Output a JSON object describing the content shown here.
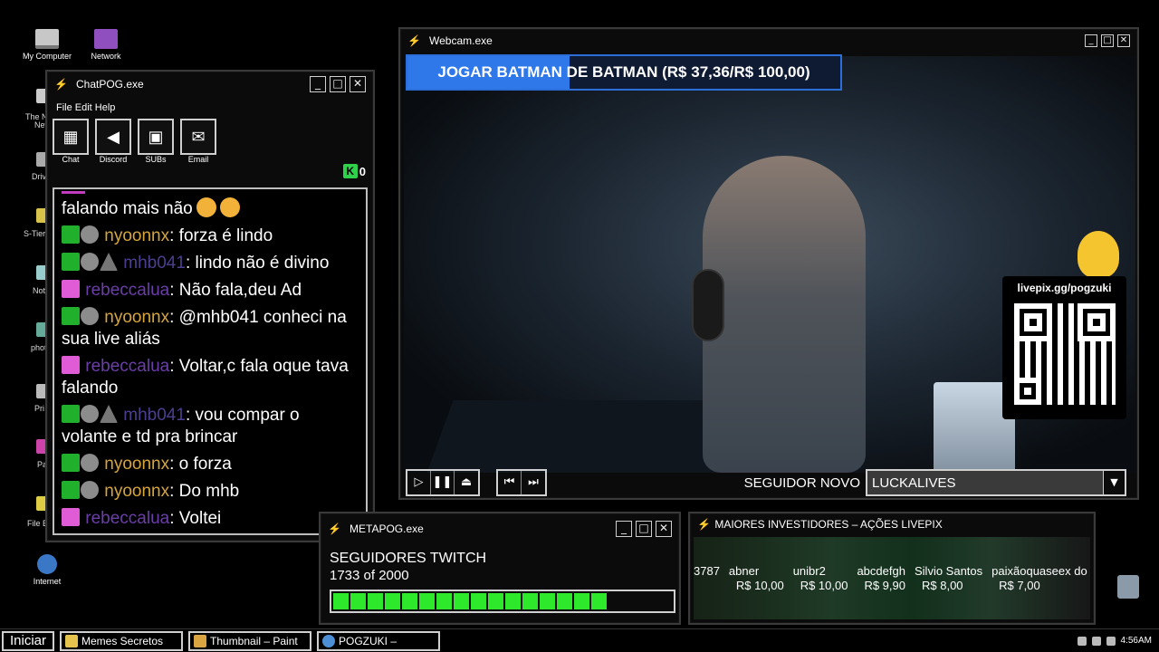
{
  "desktop": {
    "icons": [
      {
        "label": "My Computer"
      },
      {
        "label": "Network"
      },
      {
        "label": "Internet"
      }
    ],
    "fragments": [
      "The N",
      "Net",
      "Driv",
      "S-Tier",
      "Not",
      "photo",
      "Pri",
      "Pa",
      "File E"
    ]
  },
  "chat_window": {
    "title": "ChatPOG.exe",
    "menu": "File Edit Help",
    "tools": [
      {
        "label": "Chat"
      },
      {
        "label": "Discord"
      },
      {
        "label": "SUBs"
      },
      {
        "label": "Email"
      }
    ],
    "k_count": "0",
    "messages": [
      {
        "user": "",
        "text": "falando mais não",
        "user_color": "#ffffff"
      },
      {
        "user": "nyoonnx",
        "text": ": forza é lindo",
        "user_color": "#d7a53b"
      },
      {
        "user": "mhb041",
        "text": ": lindo não é divino",
        "user_color": "#4b3f8f"
      },
      {
        "user": "rebeccalua",
        "text": ": Não fala,deu Ad",
        "user_color": "#6b3ea8"
      },
      {
        "user": "nyoonnx",
        "text": ": @mhb041 conheci na sua live aliás",
        "user_color": "#d7a53b"
      },
      {
        "user": "rebeccalua",
        "text": ": Voltar,c fala oque tava falando",
        "user_color": "#6b3ea8"
      },
      {
        "user": "mhb041",
        "text": ": vou compar o volante e td pra brincar",
        "user_color": "#4b3f8f"
      },
      {
        "user": "nyoonnx",
        "text": ": o forza",
        "user_color": "#d7a53b"
      },
      {
        "user": "nyoonnx",
        "text": ": Do mhb",
        "user_color": "#d7a53b"
      },
      {
        "user": "rebeccalua",
        "text": ": Voltei",
        "user_color": "#6b3ea8"
      }
    ]
  },
  "webcam_window": {
    "title": "Webcam.exe",
    "goal_text": "JOGAR BATMAN DE BATMAN (R$ 37,36/R$ 100,00)",
    "goal_progress": 0.3736,
    "qr_url": "livepix.gg/pogzuki",
    "follower_label": "SEGUIDOR NOVO",
    "follower_value": "LUCKALIVES"
  },
  "meta_window": {
    "title": "METAPOG.exe",
    "heading": "SEGUIDORES TWITCH",
    "count": "1733 of 2000",
    "progress": 0.8665
  },
  "investors_window": {
    "title": "MAIORES INVESTIDORES – AÇÕES LIVEPIX",
    "items": [
      {
        "name": "3787",
        "amount": ""
      },
      {
        "name": "abner",
        "amount": "R$ 10,00"
      },
      {
        "name": "unibr2",
        "amount": "R$ 10,00"
      },
      {
        "name": "abcdefgh",
        "amount": "R$ 9,90"
      },
      {
        "name": "Silvio Santos",
        "amount": "R$ 8,00"
      },
      {
        "name": "paixãoquaseex do p",
        "amount": "R$ 7,00"
      }
    ]
  },
  "taskbar": {
    "start": "Iniciar",
    "tasks": [
      {
        "label": "Memes Secretos"
      },
      {
        "label": "Thumbnail – Paint"
      },
      {
        "label": "POGZUKI – Google"
      }
    ],
    "clock": "4:56AM"
  }
}
